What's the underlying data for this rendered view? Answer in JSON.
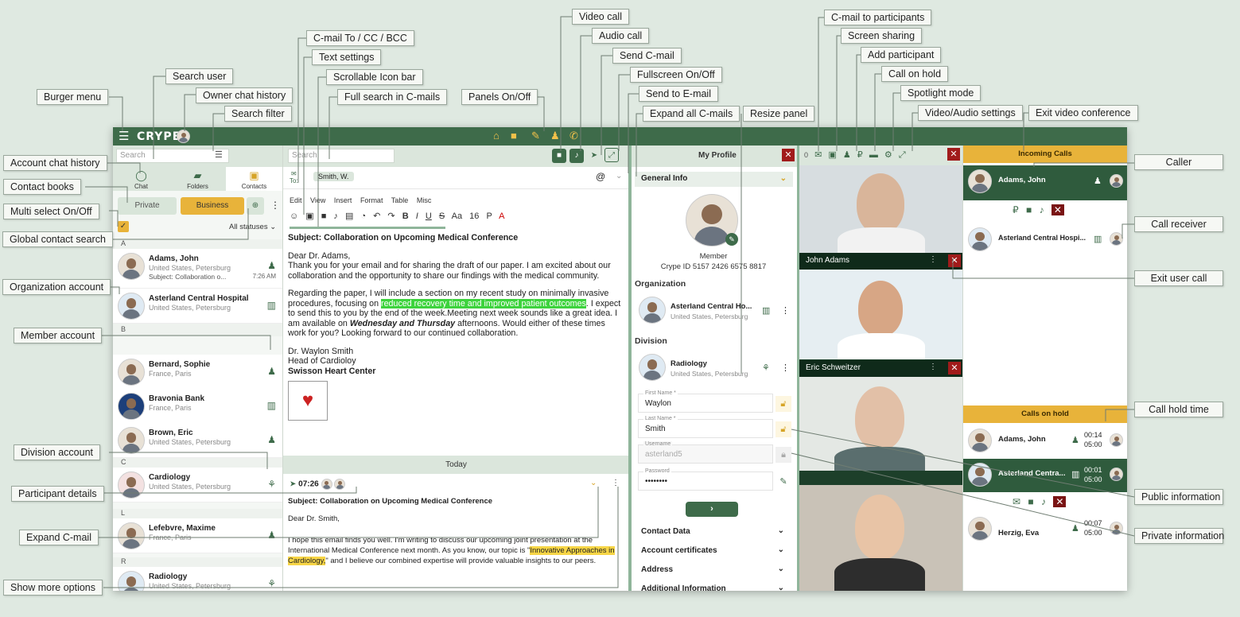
{
  "callouts": {
    "burger_menu": "Burger menu",
    "search_user": "Search user",
    "owner_chat_history": "Owner chat history",
    "search_filter": "Search filter",
    "account_chat_history": "Account chat history",
    "contact_books": "Contact books",
    "multi_select": "Multi select On/Off",
    "global_contact_search": "Global contact search",
    "organization_account": "Organization account",
    "member_account": "Member account",
    "division_account": "Division account",
    "participant_details": "Participant details",
    "expand_cmail": "Expand C-mail",
    "show_more_options": "Show more options",
    "cmail_to_cc_bcc": "C-mail To / CC / BCC",
    "text_settings": "Text settings",
    "scrollable_icon_bar": "Scrollable Icon bar",
    "full_search_cmails": "Full search in C-mails",
    "panels_onoff": "Panels On/Off",
    "video_call": "Video call",
    "audio_call": "Audio call",
    "send_cmail": "Send C-mail",
    "fullscreen": "Fullscreen On/Off",
    "send_to_email": "Send to E-mail",
    "expand_all_cmails": "Expand all C-mails",
    "resize_panel": "Resize panel",
    "cmail_to_participants": "C-mail to participants",
    "screen_sharing": "Screen sharing",
    "add_participant": "Add participant",
    "call_on_hold": "Call on hold",
    "spotlight_mode": "Spotlight mode",
    "video_audio_settings": "Video/Audio settings",
    "exit_video_conference": "Exit video conference",
    "caller": "Caller",
    "call_receiver": "Call receiver",
    "exit_user_call": "Exit user call",
    "call_hold_time": "Call hold time",
    "public_information": "Public information",
    "private_information": "Private information"
  },
  "app": {
    "logo": "CRYPE",
    "left": {
      "search_placeholder": "Search",
      "tabs": [
        "Chat",
        "Folders",
        "Contacts"
      ],
      "private_label": "Private",
      "business_label": "Business",
      "statuses_label": "All statuses",
      "letters": [
        "A",
        "B",
        "C",
        "L",
        "R"
      ],
      "contacts": [
        {
          "name": "Adams, John",
          "sub": "United States, Petersburg",
          "sub2": "Subject: Collaboration o...",
          "time": "7:26 AM"
        },
        {
          "name": "Asterland Central Hospital",
          "sub": "United States, Petersburg"
        },
        {
          "name": "Bernard, Sophie",
          "sub": "France, Paris"
        },
        {
          "name": "Bravonia Bank",
          "sub": "France, Paris"
        },
        {
          "name": "Brown, Eric",
          "sub": "United States, Petersburg"
        },
        {
          "name": "Cardiology",
          "sub": "United States, Petersburg"
        },
        {
          "name": "Lefebvre, Maxime",
          "sub": "France, Paris"
        },
        {
          "name": "Radiology",
          "sub": "United States, Petersburg"
        }
      ]
    },
    "middle": {
      "search_placeholder": "Search",
      "to_label": "To:",
      "recipient": "Smith, W.",
      "menu": [
        "Edit",
        "View",
        "Insert",
        "Format",
        "Table",
        "Misc"
      ],
      "font_size": "16",
      "para": "P",
      "subject": "Subject: Collaboration on Upcoming Medical Conference",
      "greeting": "Dear Dr. Adams,",
      "p1": "Thank you for your email and for sharing the draft of our paper. I am excited about our collaboration and the opportunity to share our findings with the medical community.",
      "p2_a": "Regarding the paper, I will include a section on my recent study on minimally invasive procedures, focusing on ",
      "p2_hl": "reduced recovery time and improved patient outcomes",
      "p2_b": ". I expect to send this to you by the end of the week.Meeting next week sounds like a great idea. I am available on ",
      "p2_em": "Wednesday and Thursday",
      "p2_c": " afternoons. Would either of these times work for you? Looking forward to our continued collaboration.",
      "sig1": "Dr. Waylon Smith",
      "sig2": "Head of Cardioloy",
      "sig3": "Swisson Heart Center",
      "today": "Today",
      "msg_time": "07:26",
      "msg_subject": "Subject: Collaboration on Upcoming Medical Conference",
      "msg_greeting": "Dear Dr. Smith,",
      "msg_a": "I hope this email finds you well. I'm writing to discuss our upcoming joint presentation at the International Medical Conference next month. As you know, our topic is \"",
      "msg_hl": "Innovative Approaches in Cardiology,",
      "msg_b": "\" and I believe our combined expertise will provide valuable insights to our peers."
    },
    "profile": {
      "title": "My Profile",
      "general_info": "General Info",
      "role": "Member",
      "crype_id": "Crype ID 5157 2426 6575 8817",
      "organization_hdr": "Organization",
      "org_name": "Asterland Central Ho...",
      "org_sub": "United States, Petersburg",
      "division_hdr": "Division",
      "div_name": "Radiology",
      "div_sub": "United States, Petersburg",
      "first_name_label": "First Name *",
      "first_name": "Waylon",
      "last_name_label": "Last Name *",
      "last_name": "Smith",
      "username_label": "Username",
      "username": "asterland5",
      "password_label": "Password",
      "password": "••••••••",
      "sections": [
        "Contact Data",
        "Account certificates",
        "Address",
        "Additional Information"
      ]
    },
    "video": {
      "participants_count": "0",
      "tiles": [
        "John Adams",
        "Eric Schweitzer"
      ]
    },
    "calls": {
      "incoming_hdr": "Incoming Calls",
      "caller": "Adams, John",
      "receiver": "Asterland Central Hospi...",
      "hold_hdr": "Calls on hold",
      "hold": [
        {
          "name": "Adams, John",
          "t1": "00:14",
          "t2": "05:00"
        },
        {
          "name": "Asterland Centra...",
          "t1": "00:01",
          "t2": "05:00"
        },
        {
          "name": "Herzig, Eva",
          "t1": "00:07",
          "t2": "05:00"
        }
      ]
    }
  }
}
